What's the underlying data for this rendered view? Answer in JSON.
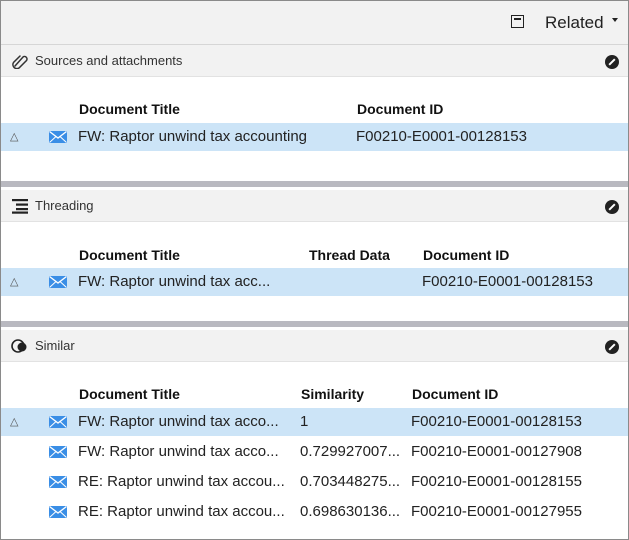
{
  "topbar": {
    "related_label": "Related"
  },
  "sources": {
    "title": "Sources and attachments",
    "columns": {
      "title": "Document Title",
      "doc_id": "Document ID"
    },
    "rows": [
      {
        "title": "FW: Raptor unwind tax accounting",
        "doc_id": "F00210-E0001-00128153",
        "selected": true
      }
    ]
  },
  "threading": {
    "title": "Threading",
    "columns": {
      "title": "Document Title",
      "thread": "Thread Data",
      "doc_id": "Document ID"
    },
    "rows": [
      {
        "title": "FW: Raptor unwind tax acc...",
        "thread": "",
        "doc_id": "F00210-E0001-00128153",
        "selected": true
      }
    ]
  },
  "similar": {
    "title": "Similar",
    "columns": {
      "title": "Document Title",
      "similarity": "Similarity",
      "doc_id": "Document ID"
    },
    "rows": [
      {
        "title": "FW: Raptor unwind tax acco...",
        "similarity": "1",
        "doc_id": "F00210-E0001-00128153",
        "selected": true
      },
      {
        "title": "FW: Raptor unwind tax acco...",
        "similarity": "0.729927007...",
        "doc_id": "F00210-E0001-00127908",
        "selected": false
      },
      {
        "title": "RE: Raptor unwind tax accou...",
        "similarity": "0.703448275...",
        "doc_id": "F00210-E0001-00128155",
        "selected": false
      },
      {
        "title": "RE: Raptor unwind tax accou...",
        "similarity": "0.698630136...",
        "doc_id": "F00210-E0001-00127955",
        "selected": false
      }
    ]
  },
  "icons": {
    "expand": "triangle-icon",
    "email": "email-icon",
    "close": "close-circle-icon"
  },
  "colors": {
    "selected_row": "#cce4f7",
    "email_icon": "#3a8ee6",
    "separator": "#b9b9c0"
  }
}
